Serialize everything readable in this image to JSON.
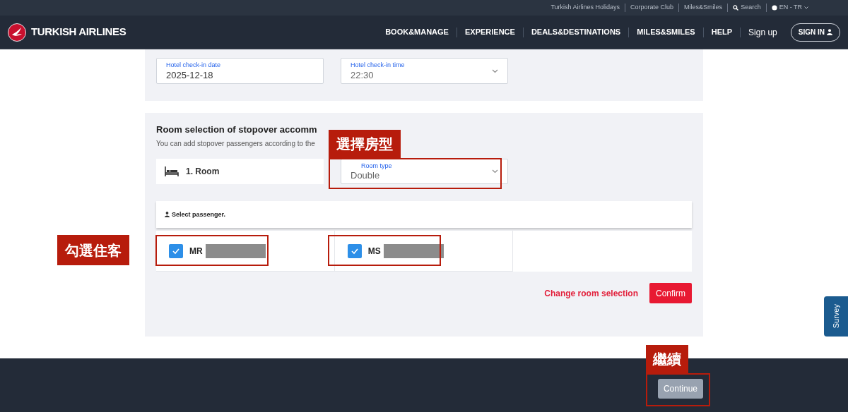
{
  "utility_links": [
    "Turkish Airlines Holidays",
    "Corporate Club",
    "Miles&Smiles"
  ],
  "search": {
    "label": "Search"
  },
  "language": {
    "label": "EN - TR"
  },
  "brand": {
    "name": "TURKISH AIRLINES"
  },
  "nav": [
    "BOOK&MANAGE",
    "EXPERIENCE",
    "DEALS&DESTINATIONS",
    "MILES&SMILES",
    "HELP"
  ],
  "sign_up": "Sign up",
  "sign_in": "SIGN IN",
  "checkin": {
    "date": {
      "label": "Hotel check-in date",
      "value": "2025-12-18"
    },
    "time": {
      "label": "Hotel check-in time",
      "value": "22:30"
    }
  },
  "room_section": {
    "title": "Room selection of stopover accomm",
    "subtitle": "You can add stopover passengers according to the",
    "room": {
      "label": "1. Room"
    },
    "room_type": {
      "label": "Room type",
      "value": "Double"
    },
    "passenger_header": "Select passenger.",
    "passengers": [
      {
        "title": "MR",
        "checked": true
      },
      {
        "title": "MS",
        "checked": true
      }
    ],
    "change_link": "Change room selection",
    "confirm": "Confirm"
  },
  "continue": {
    "label": "Continue",
    "disabled": true
  },
  "survey": "Survey",
  "annotations": [
    "選擇房型",
    "勾選住客",
    "繼續"
  ]
}
